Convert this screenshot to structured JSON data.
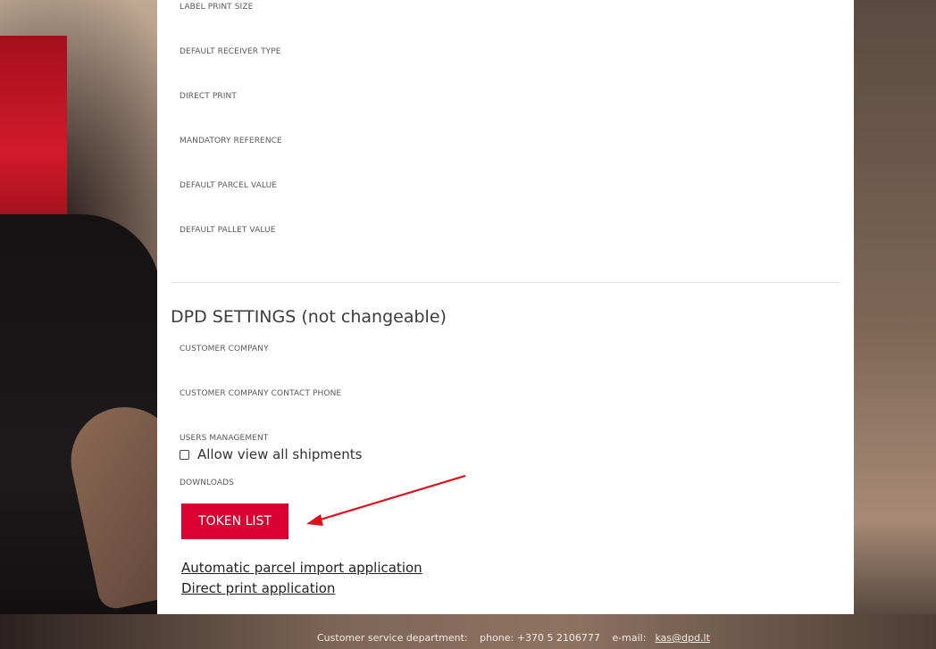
{
  "user_settings": {
    "fields": [
      "LABEL PRINT SIZE",
      "DEFAULT RECEIVER TYPE",
      "DIRECT PRINT",
      "MANDATORY REFERENCE",
      "DEFAULT PARCEL VALUE",
      "DEFAULT PALLET VALUE"
    ]
  },
  "dpd_settings": {
    "title": "DPD SETTINGS (not changeable)",
    "customer_company_label": "CUSTOMER COMPANY",
    "customer_phone_label": "CUSTOMER COMPANY CONTACT PHONE",
    "users_management_label": "USERS MANAGEMENT",
    "allow_view_label": "Allow view all shipments",
    "allow_view_checked": false,
    "downloads_label": "DOWNLOADS",
    "token_button_label": "TOKEN LIST",
    "links": [
      "Automatic parcel import application",
      "Direct print application"
    ]
  },
  "colors": {
    "brand_red": "#dc0032",
    "annotation_arrow": "#e0101a"
  },
  "footer": {
    "department": "Customer service department:",
    "phone": "phone: +370 5 2106777",
    "email_prefix": "e-mail:",
    "email": "kas@dpd.lt"
  }
}
